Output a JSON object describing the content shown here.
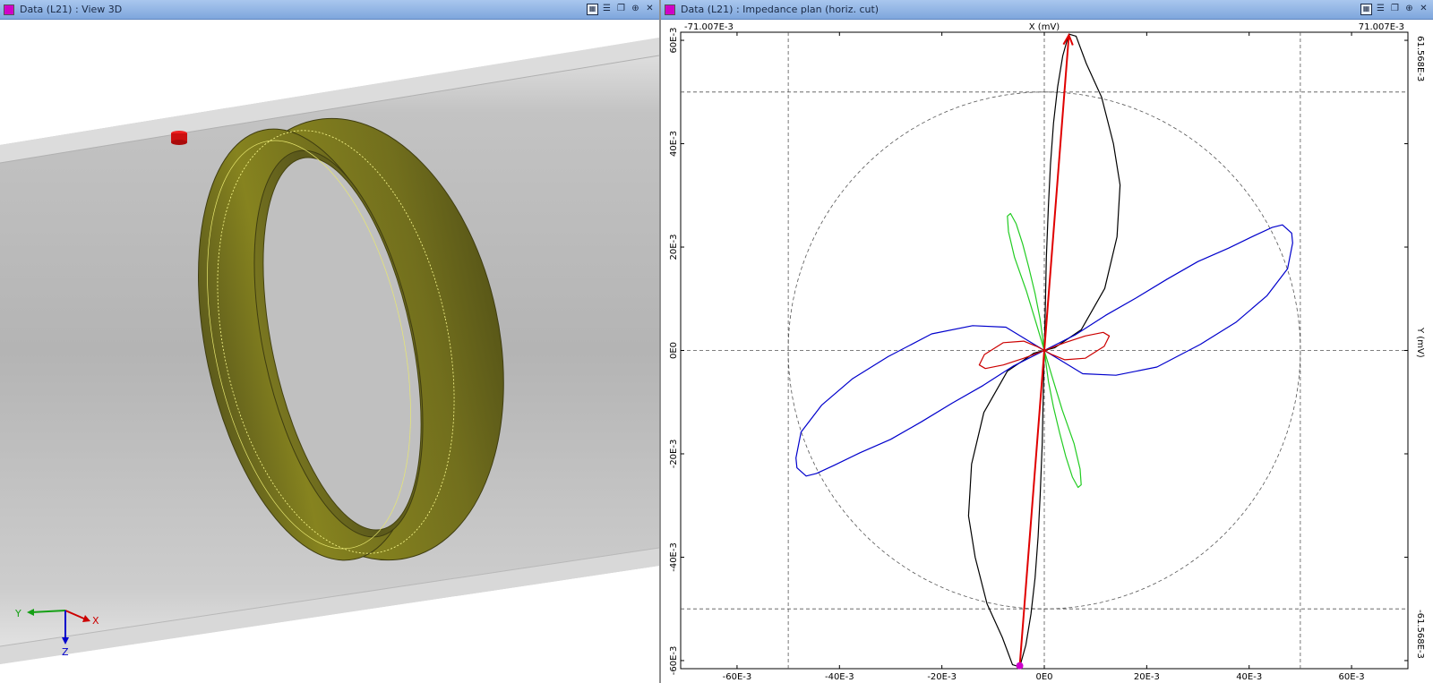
{
  "left_window": {
    "title": "Data (L21) : View 3D",
    "axis_labels": {
      "x": "X",
      "y": "Y",
      "z": "Z"
    }
  },
  "right_window": {
    "title": "Data (L21) : Impedance plan (horiz. cut)"
  },
  "window_buttons": [
    "grid-icon",
    "stack-icon",
    "restore-icon",
    "pin-icon",
    "close-icon"
  ],
  "chart_data": {
    "type": "line",
    "title": "",
    "xlabel": "X (mV)",
    "ylabel": "Y (mV)",
    "xlim": [
      -0.071007,
      0.071007
    ],
    "ylim": [
      -0.061568,
      0.061568
    ],
    "corner_labels": {
      "top_left": "-71.007E-3",
      "top_right": "71.007E-3",
      "right_top": "61.568E-3",
      "right_bottom": "-61.568E-3"
    },
    "x_ticks": [
      {
        "v": -0.06,
        "label": "-60E-3"
      },
      {
        "v": -0.04,
        "label": "-40E-3"
      },
      {
        "v": -0.02,
        "label": "-20E-3"
      },
      {
        "v": 0,
        "label": "0E0"
      },
      {
        "v": 0.02,
        "label": "20E-3"
      },
      {
        "v": 0.04,
        "label": "40E-3"
      },
      {
        "v": 0.06,
        "label": "60E-3"
      }
    ],
    "y_ticks": [
      {
        "v": 0.06,
        "label": "60E-3"
      },
      {
        "v": 0.04,
        "label": "40E-3"
      },
      {
        "v": 0.02,
        "label": "20E-3"
      },
      {
        "v": 0,
        "label": "0E0"
      },
      {
        "v": -0.02,
        "label": "-20E-3"
      },
      {
        "v": -0.04,
        "label": "-40E-3"
      },
      {
        "v": -0.06,
        "label": "-60E-3"
      }
    ],
    "grid_dashed_x": [
      -0.05,
      0,
      0.05
    ],
    "grid_dashed_y": [
      0.05,
      0,
      -0.05
    ],
    "reference_circle_radius": 0.05,
    "vector": {
      "from": [
        -0.0048,
        -0.061
      ],
      "to": [
        0.0048,
        0.061
      ],
      "color": "#e00000"
    },
    "series": [
      {
        "color": "#000000",
        "points": [
          [
            0,
            0
          ],
          [
            0.0002,
            0.008
          ],
          [
            0.0004,
            0.018
          ],
          [
            0.0008,
            0.028
          ],
          [
            0.0012,
            0.036
          ],
          [
            0.0018,
            0.044
          ],
          [
            0.0026,
            0.051
          ],
          [
            0.0036,
            0.057
          ],
          [
            0.0048,
            0.0612
          ],
          [
            0.0062,
            0.0608
          ],
          [
            0.0082,
            0.0555
          ],
          [
            0.0112,
            0.049
          ],
          [
            0.0135,
            0.04
          ],
          [
            0.0148,
            0.032
          ],
          [
            0.0142,
            0.022
          ],
          [
            0.0118,
            0.012
          ],
          [
            0.0072,
            0.004
          ],
          [
            0.002,
            0.0005
          ],
          [
            0,
            0
          ],
          [
            -0.002,
            -0.0005
          ],
          [
            -0.0072,
            -0.004
          ],
          [
            -0.0118,
            -0.012
          ],
          [
            -0.0142,
            -0.022
          ],
          [
            -0.0148,
            -0.032
          ],
          [
            -0.0135,
            -0.04
          ],
          [
            -0.0112,
            -0.049
          ],
          [
            -0.0082,
            -0.0555
          ],
          [
            -0.0062,
            -0.0608
          ],
          [
            -0.0048,
            -0.0612
          ],
          [
            -0.0036,
            -0.057
          ],
          [
            -0.0026,
            -0.051
          ],
          [
            -0.0018,
            -0.044
          ],
          [
            -0.0012,
            -0.036
          ],
          [
            -0.0008,
            -0.028
          ],
          [
            -0.0004,
            -0.018
          ],
          [
            -0.0002,
            -0.008
          ],
          [
            0,
            0
          ]
        ]
      },
      {
        "color": "#0000cc",
        "points": [
          [
            0,
            0
          ],
          [
            0.006,
            0.003
          ],
          [
            0.012,
            0.0068
          ],
          [
            0.018,
            0.0102
          ],
          [
            0.024,
            0.0138
          ],
          [
            0.03,
            0.0172
          ],
          [
            0.036,
            0.0198
          ],
          [
            0.041,
            0.0222
          ],
          [
            0.0445,
            0.0238
          ],
          [
            0.0465,
            0.0243
          ],
          [
            0.0483,
            0.0227
          ],
          [
            0.0485,
            0.0208
          ],
          [
            0.0475,
            0.0158
          ],
          [
            0.0435,
            0.0106
          ],
          [
            0.0375,
            0.0055
          ],
          [
            0.0305,
            0.0012
          ],
          [
            0.022,
            -0.0032
          ],
          [
            0.014,
            -0.0048
          ],
          [
            0.0075,
            -0.0045
          ],
          [
            0.003,
            -0.0018
          ],
          [
            0,
            0
          ],
          [
            -0.003,
            0.0018
          ],
          [
            -0.0075,
            0.0045
          ],
          [
            -0.014,
            0.0048
          ],
          [
            -0.022,
            0.0032
          ],
          [
            -0.0305,
            -0.0012
          ],
          [
            -0.0375,
            -0.0055
          ],
          [
            -0.0435,
            -0.0106
          ],
          [
            -0.0475,
            -0.0158
          ],
          [
            -0.0485,
            -0.0208
          ],
          [
            -0.0483,
            -0.0227
          ],
          [
            -0.0465,
            -0.0243
          ],
          [
            -0.0445,
            -0.0238
          ],
          [
            -0.041,
            -0.0222
          ],
          [
            -0.036,
            -0.0198
          ],
          [
            -0.03,
            -0.0172
          ],
          [
            -0.024,
            -0.0138
          ],
          [
            -0.018,
            -0.0102
          ],
          [
            -0.012,
            -0.0068
          ],
          [
            -0.006,
            -0.003
          ],
          [
            0,
            0
          ]
        ]
      },
      {
        "color": "#22cc22",
        "points": [
          [
            0,
            0
          ],
          [
            -0.0008,
            0.006
          ],
          [
            -0.0018,
            0.011
          ],
          [
            -0.003,
            0.016
          ],
          [
            -0.0042,
            0.0205
          ],
          [
            -0.0055,
            0.0245
          ],
          [
            -0.0066,
            0.0265
          ],
          [
            -0.0072,
            0.026
          ],
          [
            -0.007,
            0.023
          ],
          [
            -0.0058,
            0.018
          ],
          [
            -0.0035,
            0.0115
          ],
          [
            -0.0015,
            0.005
          ],
          [
            0,
            0
          ],
          [
            0.0015,
            -0.005
          ],
          [
            0.0035,
            -0.0115
          ],
          [
            0.0058,
            -0.018
          ],
          [
            0.007,
            -0.023
          ],
          [
            0.0072,
            -0.026
          ],
          [
            0.0066,
            -0.0265
          ],
          [
            0.0055,
            -0.0245
          ],
          [
            0.0042,
            -0.0205
          ],
          [
            0.003,
            -0.016
          ],
          [
            0.0018,
            -0.011
          ],
          [
            0.0008,
            -0.006
          ],
          [
            0,
            0
          ]
        ]
      },
      {
        "color": "#cc0000",
        "points": [
          [
            0,
            0
          ],
          [
            0.004,
            0.0015
          ],
          [
            0.008,
            0.0028
          ],
          [
            0.0115,
            0.0035
          ],
          [
            0.0127,
            0.0028
          ],
          [
            0.0117,
            0.0008
          ],
          [
            0.008,
            -0.0015
          ],
          [
            0.004,
            -0.0018
          ],
          [
            0.0015,
            -0.0008
          ],
          [
            0,
            0
          ],
          [
            -0.0015,
            0.0008
          ],
          [
            -0.004,
            0.0018
          ],
          [
            -0.008,
            0.0015
          ],
          [
            -0.0117,
            -0.0008
          ],
          [
            -0.0127,
            -0.0028
          ],
          [
            -0.0115,
            -0.0035
          ],
          [
            -0.008,
            -0.0028
          ],
          [
            -0.004,
            -0.0015
          ],
          [
            0,
            0
          ]
        ]
      }
    ]
  }
}
